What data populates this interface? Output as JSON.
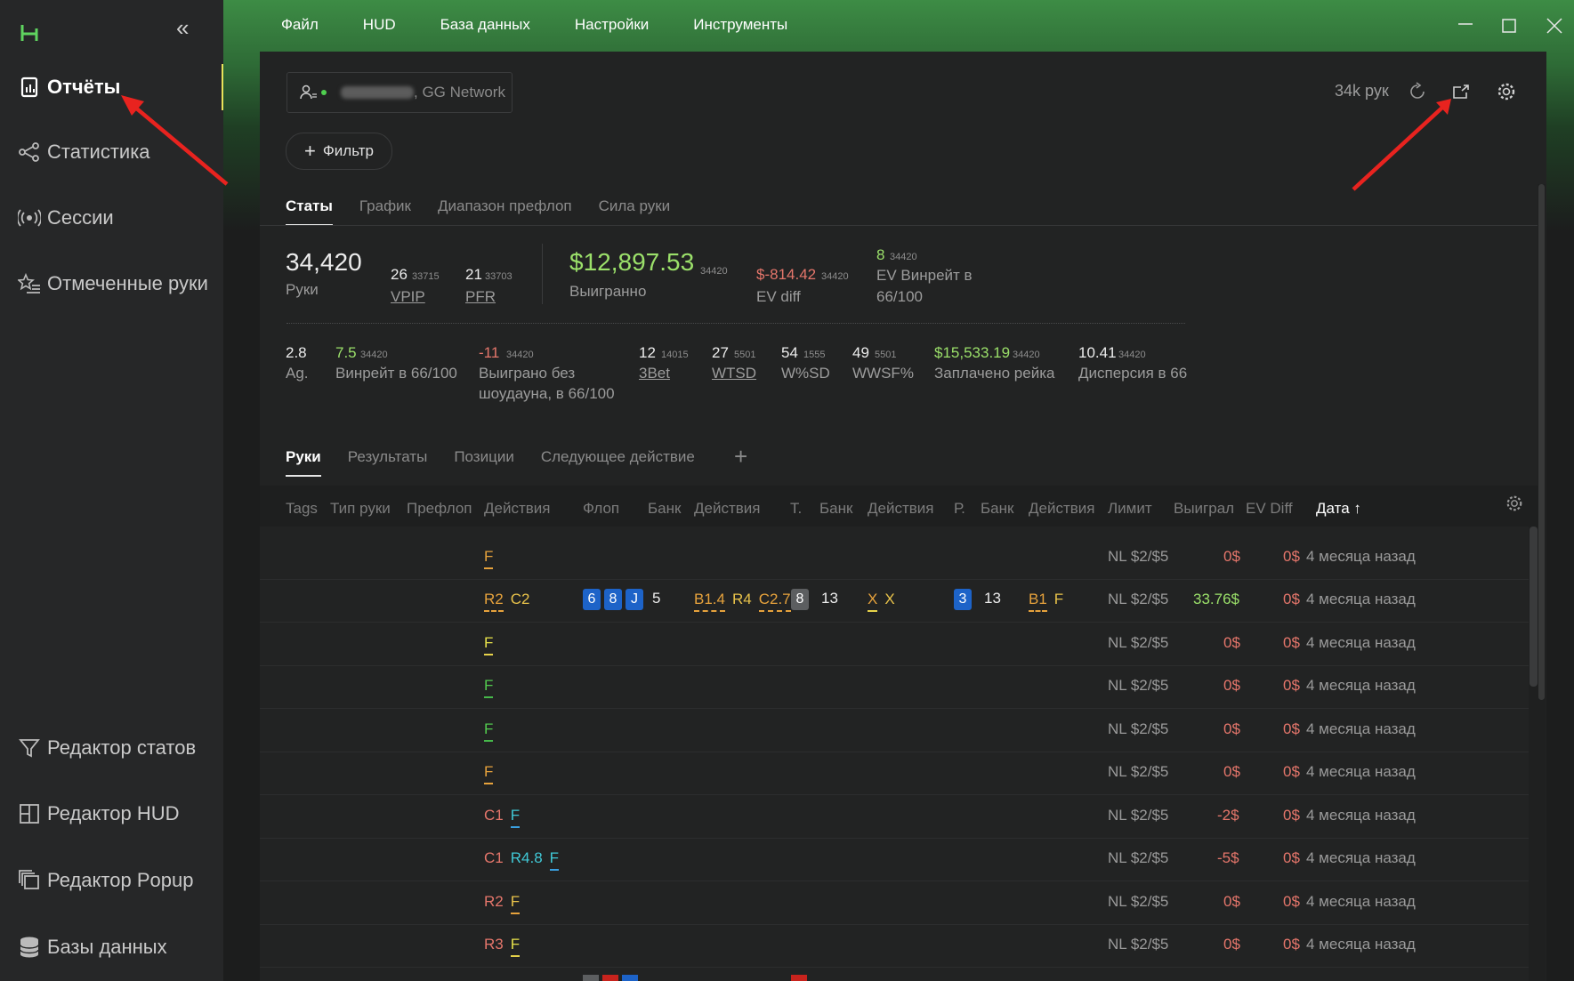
{
  "sidebar": {
    "collapse": "«",
    "items": [
      {
        "label": "Отчёты",
        "active": true,
        "icon": "report-icon"
      },
      {
        "label": "Статистика",
        "icon": "share-icon"
      },
      {
        "label": "Сессии",
        "icon": "broadcast-icon"
      },
      {
        "label": "Отмеченные руки",
        "icon": "star-list-icon"
      }
    ],
    "bottom_items": [
      {
        "label": "Редактор статов",
        "icon": "filter-icon"
      },
      {
        "label": "Редактор HUD",
        "icon": "layout-icon"
      },
      {
        "label": "Редактор Popup",
        "icon": "stack-icon"
      },
      {
        "label": "Базы данных",
        "icon": "database-icon"
      }
    ]
  },
  "menu": [
    "Файл",
    "HUD",
    "База данных",
    "Настройки",
    "Инструменты"
  ],
  "account": {
    "network": ", GG Network"
  },
  "toolbar": {
    "hands_count": "34k рук"
  },
  "filter_label": "Фильтр",
  "tabs_top": [
    "Статы",
    "График",
    "Диапазон префлоп",
    "Сила руки"
  ],
  "stats": {
    "hands": {
      "value": "34,420",
      "label": "Руки"
    },
    "vpip": {
      "value": "26",
      "sample": "33715",
      "label": "VPIP"
    },
    "pfr": {
      "value": "21",
      "sample": "33703",
      "label": "PFR"
    },
    "won": {
      "value": "$12,897.53",
      "sample": "34420",
      "label": "Выигранно"
    },
    "ev_diff": {
      "value": "$-814.42",
      "sample": "34420",
      "label": "EV diff"
    },
    "ev_winrate": {
      "value": "8",
      "sample": "34420",
      "label": "EV Винрейт в",
      "label2": "66/100"
    },
    "ag": {
      "value": "2.8",
      "label": "Ag."
    },
    "winrate": {
      "value": "7.5",
      "sample": "34420",
      "label": "Винрейт в 66/100"
    },
    "nonsd": {
      "value": "-11",
      "sample": "34420",
      "label": "Выиграно без",
      "label2": "шоудауна, в 66/100"
    },
    "threebet": {
      "value": "12",
      "sample": "14015",
      "label": "3Bet"
    },
    "wtsd": {
      "value": "27",
      "sample": "5501",
      "label": "WTSD"
    },
    "wsd": {
      "value": "54",
      "sample": "1555",
      "label": "W%SD"
    },
    "wwsf": {
      "value": "49",
      "sample": "5501",
      "label": "WWSF%"
    },
    "rake": {
      "value": "$15,533.19",
      "sample": "34420",
      "label": "Заплачено рейка"
    },
    "variance": {
      "value": "10.41",
      "sample": "34420",
      "label": "Дисперсия в 66"
    }
  },
  "tabs_bottom": [
    "Руки",
    "Результаты",
    "Позиции",
    "Следующее действие"
  ],
  "columns": [
    "Tags",
    "Тип руки",
    "Префлоп",
    "Действия",
    "Флоп",
    "Банк",
    "Действия",
    "Т.",
    "Банк",
    "Действия",
    "Р.",
    "Банк",
    "Действия",
    "Лимит",
    "Выиграл",
    "EV Diff",
    "Дата ↑"
  ],
  "rows": [
    {
      "limit": "NL $2/$5",
      "won": "0$",
      "ev": "0$",
      "date": "4 месяца назад"
    },
    {
      "limit": "NL $2/$5",
      "won": "33.76$",
      "ev": "0$",
      "date": "4 месяца назад"
    },
    {
      "limit": "NL $2/$5",
      "won": "0$",
      "ev": "0$",
      "date": "4 месяца назад"
    },
    {
      "limit": "NL $2/$5",
      "won": "0$",
      "ev": "0$",
      "date": "4 месяца назад"
    },
    {
      "limit": "NL $2/$5",
      "won": "0$",
      "ev": "0$",
      "date": "4 месяца назад"
    },
    {
      "limit": "NL $2/$5",
      "won": "0$",
      "ev": "0$",
      "date": "4 месяца назад"
    },
    {
      "limit": "NL $2/$5",
      "won": "-2$",
      "ev": "0$",
      "date": "4 месяца назад"
    },
    {
      "limit": "NL $2/$5",
      "won": "-5$",
      "ev": "0$",
      "date": "4 месяца назад"
    },
    {
      "limit": "NL $2/$5",
      "won": "0$",
      "ev": "0$",
      "date": "4 месяца назад"
    },
    {
      "limit": "NL $2/$5",
      "won": "0$",
      "ev": "0$",
      "date": "4 месяца назад"
    }
  ],
  "row_actions": {
    "r0": [
      "F"
    ],
    "r1_pre": [
      "R2",
      "C2"
    ],
    "r1_flop_cards": [
      "6",
      "8",
      "J"
    ],
    "r1_flop_pot": "5",
    "r1_flop_act": [
      "B1.4",
      "R4",
      "C2.7"
    ],
    "r1_turn_card": "8",
    "r1_turn_pot": "13",
    "r1_turn_act": [
      "X",
      "X"
    ],
    "r1_river_card": "3",
    "r1_river_pot": "13",
    "r1_river_act": [
      "B1",
      "F"
    ],
    "r2": [
      "F"
    ],
    "r3": [
      "F"
    ],
    "r4": [
      "F"
    ],
    "r5": [
      "F"
    ],
    "r6": [
      "C1",
      "F"
    ],
    "r7": [
      "C1",
      "R4.8",
      "F"
    ],
    "r8": [
      "R2",
      "F"
    ],
    "r9": [
      "R3",
      "F"
    ]
  },
  "colors": {
    "accent_green": "#3d8c45",
    "positive": "#9be06a",
    "negative": "#e5766b",
    "arrow": "#e8231f"
  }
}
